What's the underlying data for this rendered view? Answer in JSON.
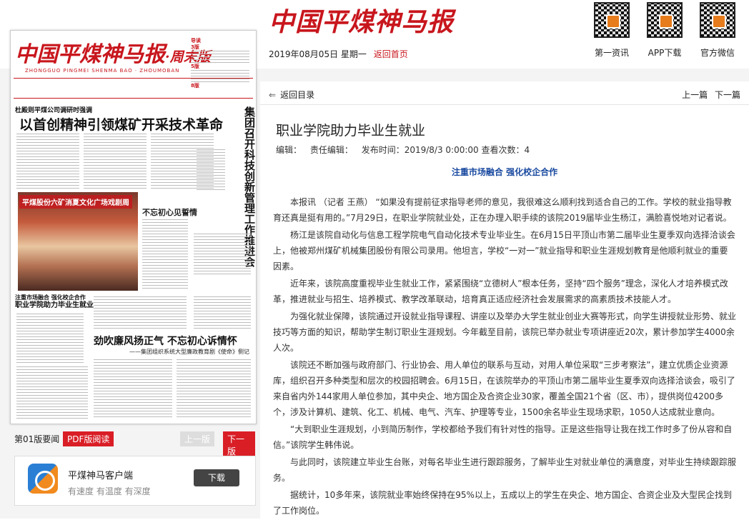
{
  "header": {
    "logo": "中国平煤神马报",
    "date": "2019年08月05日 星期一",
    "home_link": "返回首页",
    "qr": [
      {
        "label": "第一资讯",
        "icon": "qr-code-icon"
      },
      {
        "label": "APP下载",
        "icon": "qr-code-icon"
      },
      {
        "label": "官方微信",
        "icon": "qr-code-icon"
      }
    ]
  },
  "newspaper": {
    "masthead": "中国平煤神马报",
    "masthead_suffix": "·周末版",
    "pinyin": "ZHONGGUO PINGMEI SHENMA BAO · ZHOUMOBAN",
    "side_items": [
      "导读",
      "3版",
      "5版",
      "8版"
    ],
    "kicker": "杜殿则平煤公司调研时强调",
    "headline": "以首创精神引领煤矿开采技术革命",
    "vertical_headline": "集团召开科技创新管理工作推进会",
    "photo_caption": "平煤股份六矿消夏文化广场戏剧周",
    "sub1": "不忘初心见誓情",
    "sub2_line1": "注重市场融合 强化校企合作",
    "sub2_line2": "职业学院助力毕业生就业",
    "sub3": "劲吹廉风扬正气 不忘初心诉情怀",
    "sub3b": "——集团组织系统大型廉政教育剧《使命》侧记"
  },
  "pager": {
    "page_label": "第01版要闻",
    "pdf": "PDF版阅读",
    "prev": "上一版",
    "next": "下一版"
  },
  "app": {
    "name": "平煤神马客户端",
    "tagline": "有速度 有温度 有深度",
    "download": "下载"
  },
  "article": {
    "back": "返回目录",
    "prev": "上一篇",
    "next": "下一篇",
    "title": "职业学院助力毕业生就业",
    "meta": {
      "editor": "编辑：",
      "chief_editor": "责任编辑：",
      "published": "发布时间：2019/8/3 0:00:00",
      "views": "查看次数：4"
    },
    "subhead": "注重市场融合 强化校企合作",
    "paragraphs": [
      "本报讯 （记者 王燕） “如果没有提前征求指导老师的意见，我很难这么顺利找到适合自己的工作。学校的就业指导教育还真是挺有用的。”7月29日，在职业学院就业处，正在办理入职手续的该院2019届毕业生杨江，满脸喜悦地对记者说。",
      "杨江是该院自动化与信息工程学院电气自动化技术专业毕业生。在6月15日平顶山市第二届毕业生夏季双向选择洽谈会上，他被郑州煤矿机械集团股份有限公司录用。他坦言，学校“一对一”就业指导和职业生涯规划教育是他顺利就业的重要因素。",
      "近年来，该院高度重视毕业生就业工作，紧紧围绕“立德树人”根本任务，坚持“四个服务”理念，深化人才培养模式改革，推进就业与招生、培养模式、教学改革联动，培育真正适应经济社会发展需求的高素质技术技能人才。",
      "为强化就业保障，该院通过开设就业指导课程、讲座以及举办大学生就业创业大赛等形式，向学生讲授就业形势、就业技巧等方面的知识，帮助学生制订职业生涯规划。今年截至目前，该院已举办就业专项讲座近20次，累计参加学生4000余人次。",
      "该院还不断加强与政府部门、行业协会、用人单位的联系与互动，对用人单位采取“三步考察法”，建立优质企业资源库，组织召开多种类型和层次的校园招聘会。6月15日，在该院举办的平顶山市第二届毕业生夏季双向选择洽谈会，吸引了来自省内外144家用人单位参加，其中央企、地方国企及合资企业30家，覆盖全国21个省（区、市），提供岗位4200多个，涉及计算机、建筑、化工、机械、电气、汽车、护理等专业，1500余名毕业生现场求职，1050人达成就业意向。",
      "“大到职业生涯规划，小到简历制作，学校都给予我们有针对性的指导。正是这些指导让我在找工作时多了份从容和自信。”该院学生韩伟说。",
      "与此同时，该院建立毕业生台账，对每名毕业生进行跟踪服务，了解毕业生对就业单位的满意度，对毕业生持续跟踪服务。",
      "据统计，10多年来，该院就业率始终保持在95%以上，五成以上的学生在央企、地方国企、合资企业及大型民企找到了工作岗位。"
    ]
  }
}
